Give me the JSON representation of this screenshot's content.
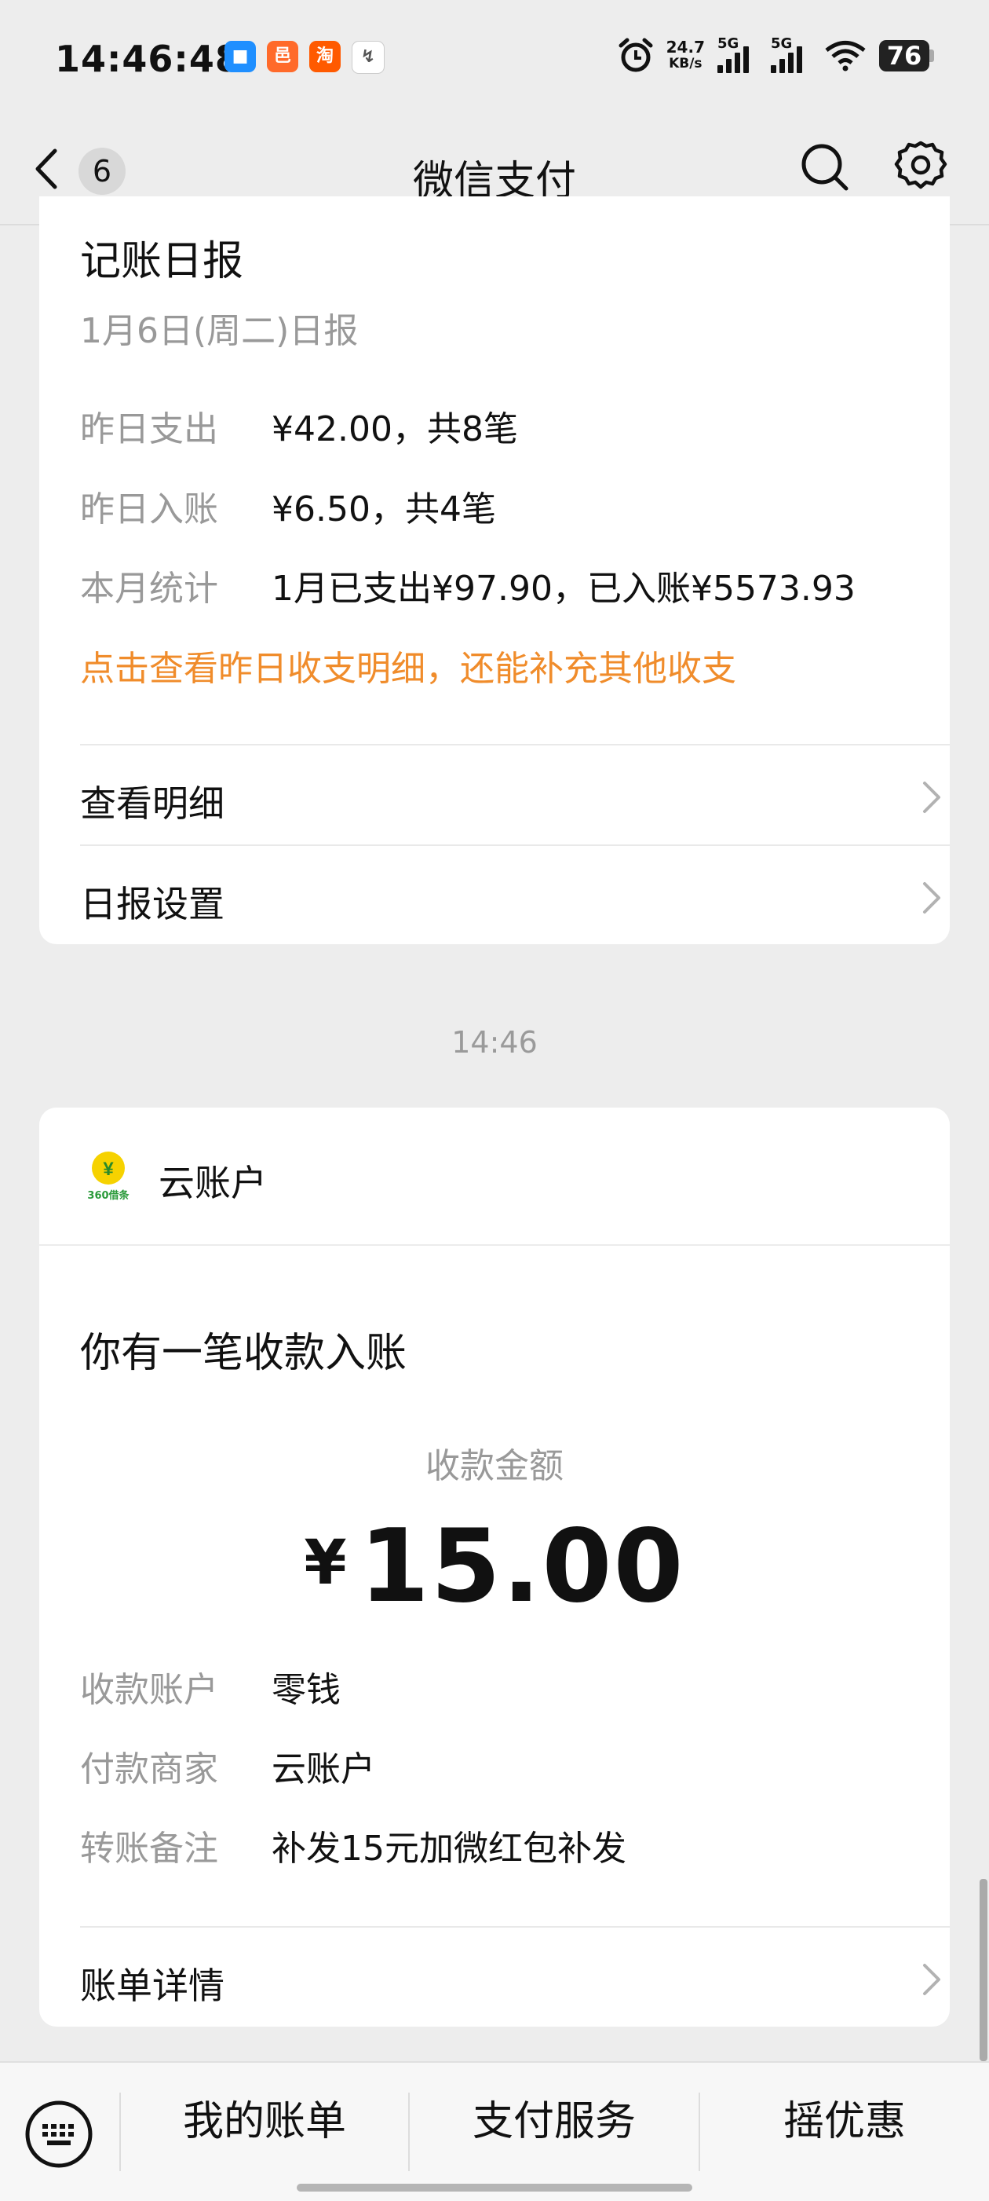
{
  "status_bar": {
    "time": "14:46:48",
    "app_icons": [
      {
        "name": "blue-app-icon",
        "color": "#1f8fff",
        "glyph": "■"
      },
      {
        "name": "orange-app-icon",
        "color": "#ff6a2a",
        "glyph": "邑"
      },
      {
        "name": "taobao-icon",
        "color": "#ff5a00",
        "glyph": "淘"
      },
      {
        "name": "gray-app-icon",
        "color": "#555555",
        "glyph": "↯"
      }
    ],
    "net_speed_value": "24.7",
    "net_speed_unit": "KB/s",
    "signal1_label": "5G",
    "signal2_label": "5G",
    "battery": "76"
  },
  "nav": {
    "back_badge": "6",
    "title": "微信支付"
  },
  "daily_report": {
    "title": "记账日报",
    "subtitle": "1月6日(周二)日报",
    "rows": [
      {
        "label": "昨日支出",
        "value": "¥42.00，共8笔"
      },
      {
        "label": "昨日入账",
        "value": "¥6.50，共4笔"
      },
      {
        "label": "本月统计",
        "value": "1月已支出¥97.90，已入账¥5573.93"
      }
    ],
    "hint": "点击查看昨日收支明细，还能补充其他收支",
    "actions": [
      {
        "label": "查看明细"
      },
      {
        "label": "日报设置"
      }
    ]
  },
  "timestamp": "14:46",
  "payment_card": {
    "merchant_name": "云账户",
    "logo_text": "360借条",
    "title": "你有一笔收款入账",
    "amount_label": "收款金额",
    "currency": "¥",
    "amount": "15.00",
    "details": [
      {
        "label": "收款账户",
        "value": "零钱"
      },
      {
        "label": "付款商家",
        "value": "云账户"
      },
      {
        "label": "转账备注",
        "value": "补发15元加微红包补发"
      }
    ],
    "footer_link": "账单详情"
  },
  "bottom_menu": {
    "items": [
      "我的账单",
      "支付服务",
      "摇优惠"
    ]
  },
  "colors": {
    "background": "#ededed",
    "card": "#ffffff",
    "accent_orange": "#f08c2b",
    "muted_text": "#999999"
  }
}
